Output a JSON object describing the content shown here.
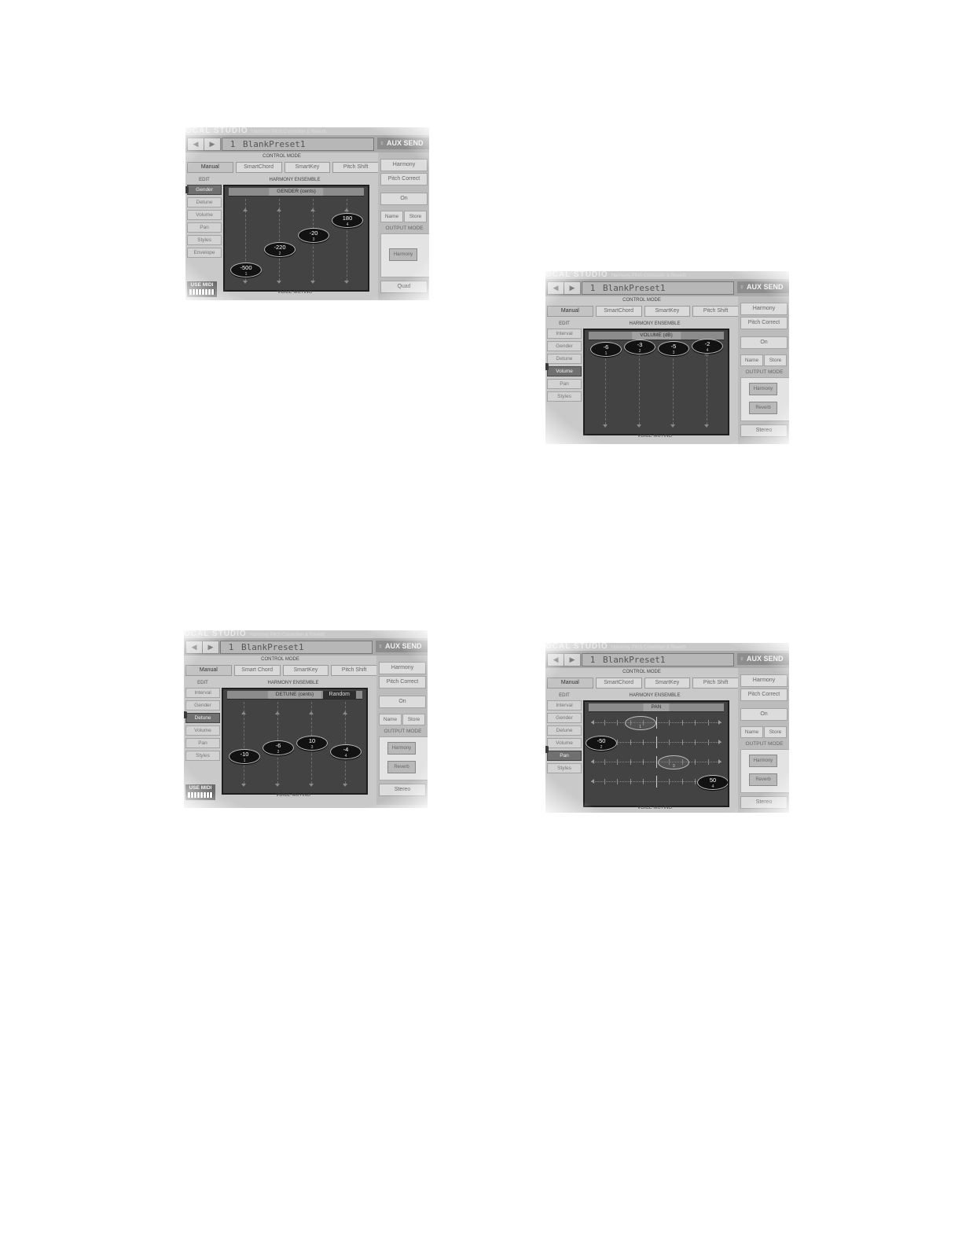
{
  "shots": {
    "gender": {
      "brand": "OCAL STUDIO",
      "brand_sub": "Harmony Pitch Correction & Reverb",
      "prev": "◀",
      "next": "▶",
      "preset_num": "1",
      "preset_name": "BlankPreset1",
      "aux": "AUX SEND",
      "control_mode_label": "CONTROL MODE",
      "modes": [
        "Manual",
        "SmartChord",
        "SmartKey",
        "Pitch Shift"
      ],
      "edit_label": "EDIT",
      "ensemble_label": "HARMONY ENSEMBLE",
      "edit_items": [
        "Gender",
        "Detune",
        "Volume",
        "Pan",
        "Styles",
        "Envelope"
      ],
      "edit_active": 0,
      "panel_title": "GENDER (cents)",
      "knobs": [
        {
          "value": "-500",
          "index": "1",
          "level": 0.14
        },
        {
          "value": "-220",
          "index": "2",
          "level": 0.39
        },
        {
          "value": "-20",
          "index": "3",
          "level": 0.57
        },
        {
          "value": "180",
          "index": "4",
          "level": 0.75
        }
      ],
      "voice_muting": "VOICE MUTING",
      "use_midi": "USE MIDI",
      "right": {
        "harmony": "Harmony",
        "pitch_correct": "Pitch Correct",
        "on": "On",
        "name": "Name",
        "store": "Store",
        "output_mode": "OUTPUT MODE",
        "om_box": "Harmony",
        "mode": "Quad"
      }
    },
    "volume": {
      "brand": "OCAL STUDIO",
      "brand_sub": "Harmony Pitch Correction & Reverb",
      "prev": "◀",
      "next": "▶",
      "preset_num": "1",
      "preset_name": "BlankPreset1",
      "aux": "AUX SEND",
      "control_mode_label": "CONTROL MODE",
      "modes": [
        "Manual",
        "SmartChord",
        "SmartKey",
        "Pitch Shift"
      ],
      "edit_label": "EDIT",
      "ensemble_label": "HARMONY ENSEMBLE",
      "edit_items": [
        "Interval",
        "Gender",
        "Detune",
        "Volume",
        "Pan",
        "Styles"
      ],
      "edit_active": 3,
      "panel_title": "VOLUME (dB)",
      "knobs": [
        {
          "value": "-6",
          "index": "1",
          "level": 0.93
        },
        {
          "value": "-3",
          "index": "2",
          "level": 0.96
        },
        {
          "value": "-5",
          "index": "3",
          "level": 0.94
        },
        {
          "value": "-2",
          "index": "4",
          "level": 0.97
        }
      ],
      "voice_muting": "VOICE MUTING",
      "use_midi": "",
      "right": {
        "harmony": "Harmony",
        "pitch_correct": "Pitch Correct",
        "on": "On",
        "name": "Name",
        "store": "Store",
        "output_mode": "OUTPUT MODE",
        "om_box": "Harmony",
        "om_box2": "Reverb",
        "mode": "Stereo"
      }
    },
    "detune": {
      "brand": "OCAL STUDIO",
      "brand_sub": "Harmony Pitch Correction & Reverb",
      "prev": "◀",
      "next": "▶",
      "preset_num": "1",
      "preset_name": "BlankPreset1",
      "aux": "AUX SEND",
      "control_mode_label": "CONTROL MODE",
      "modes": [
        "Manual",
        "Smart Chord",
        "SmartKey",
        "Pitch Shift"
      ],
      "edit_label": "EDIT",
      "ensemble_label": "HARMONY ENSEMBLE",
      "edit_items": [
        "Interval",
        "Gender",
        "Detune",
        "Volume",
        "Pan",
        "Styles"
      ],
      "edit_active": 2,
      "panel_title": "DETUNE (cents)",
      "random": "Random",
      "knobs": [
        {
          "value": "-10",
          "index": "1",
          "level": 0.35
        },
        {
          "value": "-6",
          "index": "2",
          "level": 0.45
        },
        {
          "value": "10",
          "index": "3",
          "level": 0.51
        },
        {
          "value": "-4",
          "index": "4",
          "level": 0.4
        }
      ],
      "voice_muting": "VOICE MUTING",
      "use_midi": "USE MIDI",
      "right": {
        "harmony": "Harmony",
        "pitch_correct": "Pitch Correct",
        "on": "On",
        "name": "Name",
        "store": "Store",
        "output_mode": "OUTPUT MODE",
        "om_box": "Harmony",
        "om_box2": "Reverb",
        "mode": "Stereo"
      }
    },
    "pan": {
      "brand": "OCAL STUDIO",
      "brand_sub": "Harmony Pitch Correction & Reverb",
      "prev": "◀",
      "next": "▶",
      "preset_num": "1",
      "preset_name": "BlankPreset1",
      "aux": "AUX SEND",
      "control_mode_label": "CONTROL MODE",
      "modes": [
        "Manual",
        "SmartChord",
        "SmartKey",
        "Pitch Shift"
      ],
      "edit_label": "EDIT",
      "ensemble_label": "HARMONY ENSEMBLE",
      "edit_items": [
        "Interval",
        "Gender",
        "Detune",
        "Volume",
        "Pan",
        "Styles"
      ],
      "edit_active": 4,
      "panel_title": "PAN",
      "pan_knobs": [
        {
          "value": "",
          "index": "1",
          "pan": -0.3
        },
        {
          "value": "-50",
          "index": "2",
          "pan": -1.0
        },
        {
          "value": "",
          "index": "3",
          "pan": 0.3
        },
        {
          "value": "50",
          "index": "4",
          "pan": 1.0
        }
      ],
      "voice_muting": "VOICE MUTING",
      "use_midi": "",
      "right": {
        "harmony": "Harmony",
        "pitch_correct": "Pitch Correct",
        "on": "On",
        "name": "Name",
        "store": "Store",
        "output_mode": "OUTPUT MODE",
        "om_box": "Harmony",
        "om_box2": "Reverb",
        "mode": "Stereo"
      }
    }
  }
}
